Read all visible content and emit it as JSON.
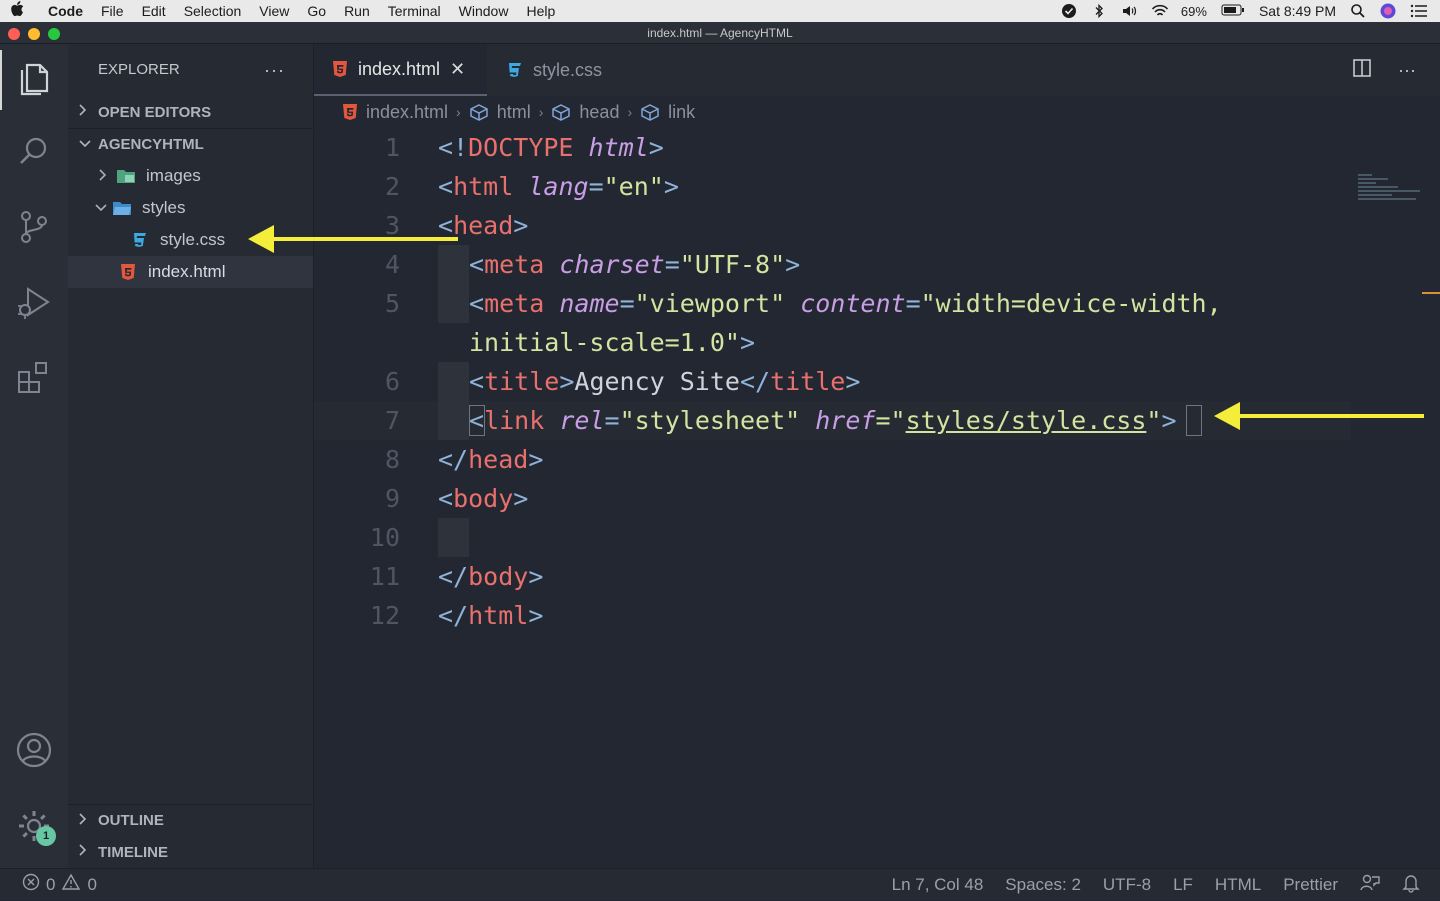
{
  "menubar": {
    "app": "Code",
    "items": [
      "File",
      "Edit",
      "Selection",
      "View",
      "Go",
      "Run",
      "Terminal",
      "Window",
      "Help"
    ],
    "battery": "69%",
    "clock": "Sat 8:49 PM"
  },
  "window": {
    "title": "index.html — AgencyHTML"
  },
  "sidebar": {
    "header": "EXPLORER",
    "open_editors": "OPEN EDITORS",
    "project": "AGENCYHTML",
    "tree": {
      "images": "images",
      "styles": "styles",
      "style_css": "style.css",
      "index_html": "index.html"
    },
    "outline": "OUTLINE",
    "timeline": "TIMELINE"
  },
  "activity": {
    "settings_badge": "1"
  },
  "tabs": {
    "active": "index.html",
    "inactive": "style.css"
  },
  "breadcrumb": {
    "file": "index.html",
    "c1": "html",
    "c2": "head",
    "c3": "link"
  },
  "code": {
    "line_numbers": [
      "1",
      "2",
      "3",
      "4",
      "5",
      "6",
      "7",
      "8",
      "9",
      "10",
      "11",
      "12"
    ],
    "l1": {
      "open": "<!",
      "tag": "DOCTYPE",
      "attr": "html",
      "close": ">"
    },
    "l2": {
      "lt": "<",
      "tag": "html",
      "attr": "lang",
      "eq": "=",
      "val": "\"en\"",
      "gt": ">"
    },
    "l3": {
      "lt": "<",
      "tag": "head",
      "gt": ">"
    },
    "l4": {
      "lt": "<",
      "tag": "meta",
      "attr": "charset",
      "eq": "=",
      "val": "\"UTF-8\"",
      "gt": ">"
    },
    "l5": {
      "lt": "<",
      "tag": "meta",
      "attr1": "name",
      "eq1": "=",
      "val1": "\"viewport\"",
      "attr2": "content",
      "eq2": "=",
      "val2": "\"width=device-width,",
      "wrap": "initial-scale=1.0\"",
      "gt": ">"
    },
    "l6": {
      "lt": "<",
      "tag": "title",
      "gt": ">",
      "text": "Agency Site",
      "lt2": "</",
      "tag2": "title",
      "gt2": ">"
    },
    "l7": {
      "lt": "<",
      "tag": "link",
      "attr1": "rel",
      "eq1": "=",
      "val1": "\"stylesheet\"",
      "attr2": "href",
      "eq2": "=\"",
      "val2": "styles/style.css",
      "q": "\"",
      "gt": ">"
    },
    "l8": {
      "lt": "</",
      "tag": "head",
      "gt": ">"
    },
    "l9": {
      "lt": "<",
      "tag": "body",
      "gt": ">"
    },
    "l11": {
      "lt": "</",
      "tag": "body",
      "gt": ">"
    },
    "l12": {
      "lt": "</",
      "tag": "html",
      "gt": ">"
    }
  },
  "status": {
    "errors": "0",
    "warnings": "0",
    "position": "Ln 7, Col 48",
    "spaces": "Spaces: 2",
    "encoding": "UTF-8",
    "eol": "LF",
    "language": "HTML",
    "formatter": "Prettier"
  },
  "colors": {
    "arrow": "#f4ee3a",
    "tag": "#e8706d",
    "attribute": "#c89ee6",
    "string": "#d3e3a0",
    "punctuation": "#8fb3d9"
  }
}
